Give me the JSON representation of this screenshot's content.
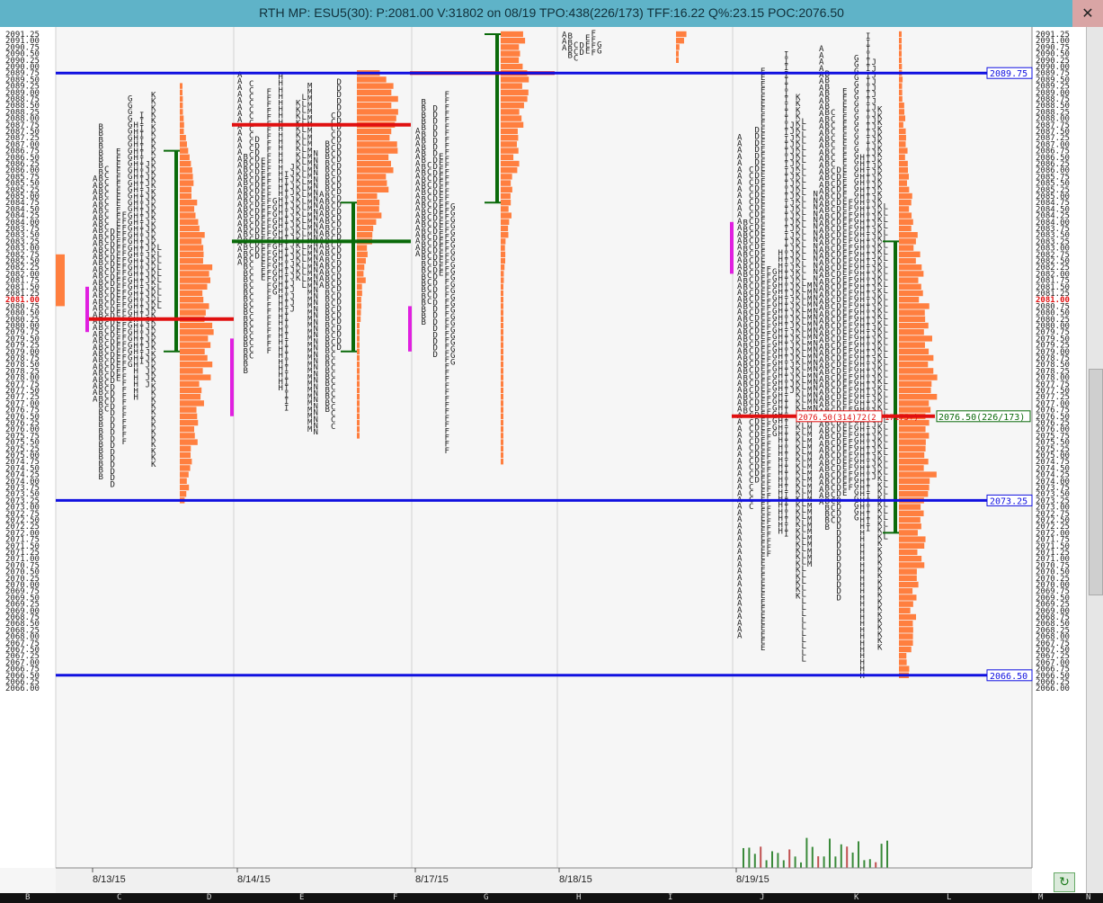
{
  "window": {
    "title": "RTH MP: ESU5(30): P:2081.00 V:31802 on 08/19 TPO:438(226/173)  TFF:16.22 Q%:23.15 POC:2076.50",
    "close_label": "✕"
  },
  "colors": {
    "level_line": "#1010e0",
    "poc": "#e01010",
    "value_area": "#0a6a0a",
    "profile": "#ff7f3f",
    "ib": "#e020e0",
    "volume": "#3a8a3a",
    "volume_high": "#c05050"
  },
  "chart_data": {
    "type": "market-profile",
    "y_range": [
      2066.0,
      2091.25
    ],
    "tick_step": 0.25,
    "current_price": 2081.0,
    "current_price_label": "2081.00",
    "horizontal_levels": [
      {
        "price": 2089.75,
        "label": "2089.75"
      },
      {
        "price": 2073.25,
        "label": "2073.25"
      },
      {
        "price": 2066.5,
        "label": "2066.50"
      }
    ],
    "dates": [
      "8/13/15",
      "8/14/15",
      "8/17/15",
      "8/18/15",
      "8/19/15"
    ],
    "poc_annotations": [
      {
        "text": "2076.50(314)72(2",
        "price": 2076.5
      },
      {
        "text": "17175+)",
        "price": 2076.5
      },
      {
        "text": "2076.50(226/173)",
        "price": 2076.5
      }
    ],
    "sessions": [
      {
        "date": "8/13/15",
        "low": 2073.25,
        "high": 2089.25,
        "poc": 2080.25,
        "va": [
          2079.0,
          2086.75
        ],
        "ib": [
          2079.75,
          2081.5
        ]
      },
      {
        "date": "8/14/15",
        "low": 2075.75,
        "high": 2089.75,
        "poc": 2087.75,
        "poc2": 2083.25,
        "va": [
          2079.0,
          2084.75
        ],
        "ib": [
          2076.5,
          2079.5
        ]
      },
      {
        "date": "8/17/15",
        "low": 2074.75,
        "high": 2091.25,
        "poc": 2089.75,
        "va": [
          2084.75,
          2091.25
        ],
        "ib": [
          2079.0,
          2080.75
        ]
      },
      {
        "date": "8/18/15",
        "low": 2090.25,
        "high": 2091.25
      },
      {
        "date": "8/19/15",
        "low": 2066.5,
        "high": 2091.25,
        "poc": 2076.5,
        "va": [
          2072.0,
          2083.25
        ],
        "ib": [
          2082.0,
          2084.0
        ]
      }
    ]
  },
  "bottom_bar": {
    "columns": [
      "B",
      "C",
      "D",
      "E",
      "F",
      "G",
      "H",
      "I",
      "J",
      "K",
      "L",
      "M",
      "N"
    ]
  },
  "toolbar": {
    "refresh_icon": "↻"
  }
}
